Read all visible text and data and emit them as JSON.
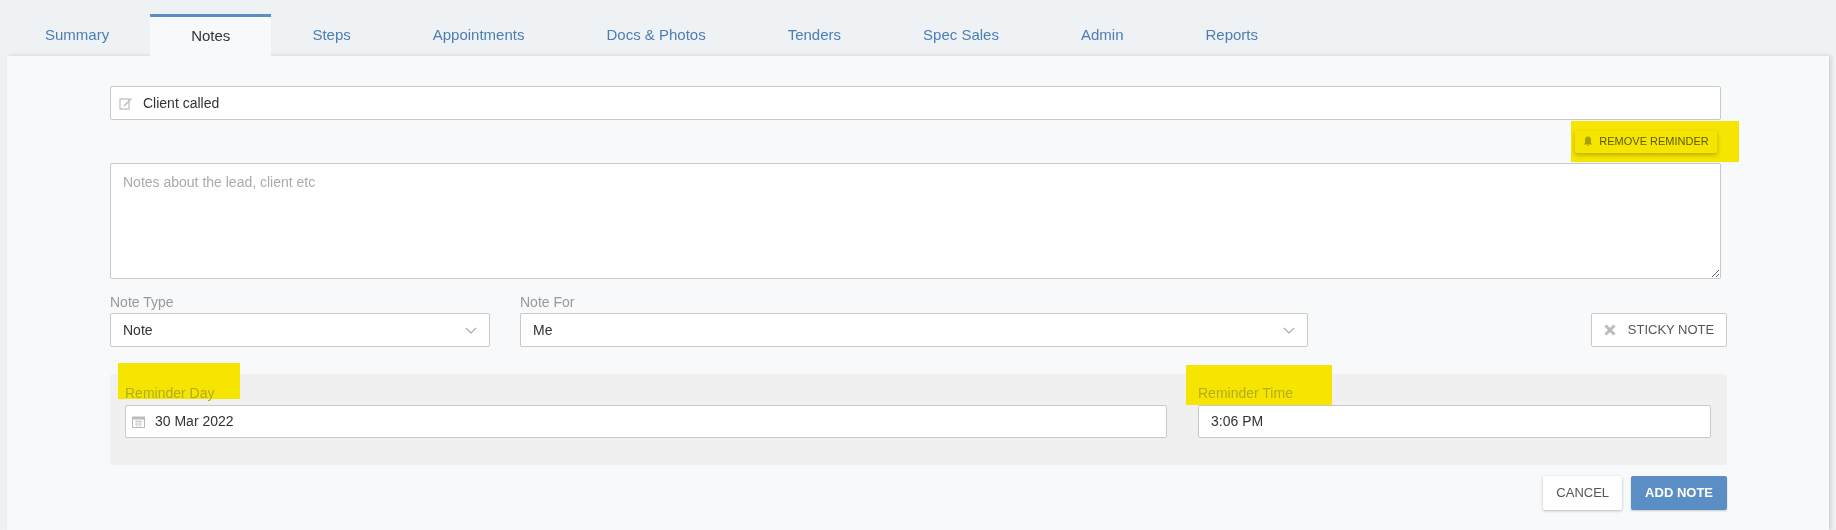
{
  "tabs": [
    {
      "label": "Summary",
      "selected": false
    },
    {
      "label": "Notes",
      "selected": true
    },
    {
      "label": "Steps",
      "selected": false
    },
    {
      "label": "Appointments",
      "selected": false
    },
    {
      "label": "Docs & Photos",
      "selected": false
    },
    {
      "label": "Tenders",
      "selected": false
    },
    {
      "label": "Spec Sales",
      "selected": false
    },
    {
      "label": "Admin",
      "selected": false
    },
    {
      "label": "Reports",
      "selected": false
    }
  ],
  "note_form": {
    "title_field": {
      "value": "Client called"
    },
    "remove_reminder_button": {
      "label": "REMOVE REMINDER",
      "highlighted": true
    },
    "notes_field": {
      "placeholder": "Notes about the lead, client etc"
    },
    "note_type": {
      "label": "Note Type",
      "value": "Note"
    },
    "note_for": {
      "label": "Note For",
      "value": "Me"
    },
    "sticky_note_button": {
      "label": "STICKY NOTE"
    },
    "reminder_day": {
      "label": "Reminder Day",
      "value": "30 Mar 2022",
      "highlighted": true
    },
    "reminder_time": {
      "label": "Reminder Time",
      "value": "3:06 PM",
      "highlighted": true
    },
    "buttons": [
      {
        "label": "CANCEL",
        "kind": "secondary"
      },
      {
        "label": "ADD NOTE",
        "kind": "primary"
      }
    ]
  }
}
